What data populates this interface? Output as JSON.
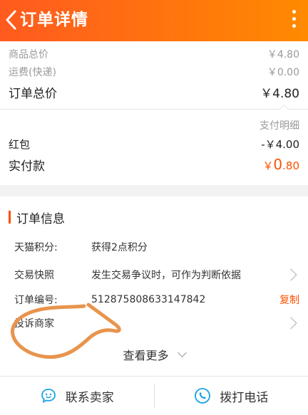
{
  "header": {
    "title": "订单详情",
    "back_icon": "chevron-left-icon",
    "more_icon": "more-vertical-icon"
  },
  "summary": {
    "goods_label": "商品总价",
    "goods_value": "￥4.80",
    "shipping_label": "运费(快递)",
    "shipping_value": "￥0.00",
    "order_total_label": "订单总价",
    "order_total_value": "￥4.80",
    "pay_detail_label": "支付明细",
    "redpacket_label": "红包",
    "redpacket_value": "-￥4.00",
    "paid_label": "实付款",
    "paid_currency": "￥",
    "paid_int": "0",
    "paid_dec": ".80"
  },
  "order_info": {
    "title": "订单信息",
    "rows": [
      {
        "label": "天猫积分:",
        "value": "获得2点积分"
      },
      {
        "label": "交易快照",
        "value": "发生交易争议时，可作为判断依据"
      },
      {
        "label": "订单编号:",
        "value": "512875808633147842",
        "action": "复制"
      },
      {
        "label": "投诉商家",
        "value": ""
      }
    ],
    "see_more": "查看更多"
  },
  "footer": {
    "contact_label": "联系卖家",
    "contact_icon": "chat-icon",
    "call_label": "拨打电话",
    "call_icon": "phone-icon"
  },
  "colors": {
    "brand": "#ff5000",
    "header_start": "#ff5a1f",
    "header_end": "#ff8a00",
    "scribble": "#e8944c"
  }
}
